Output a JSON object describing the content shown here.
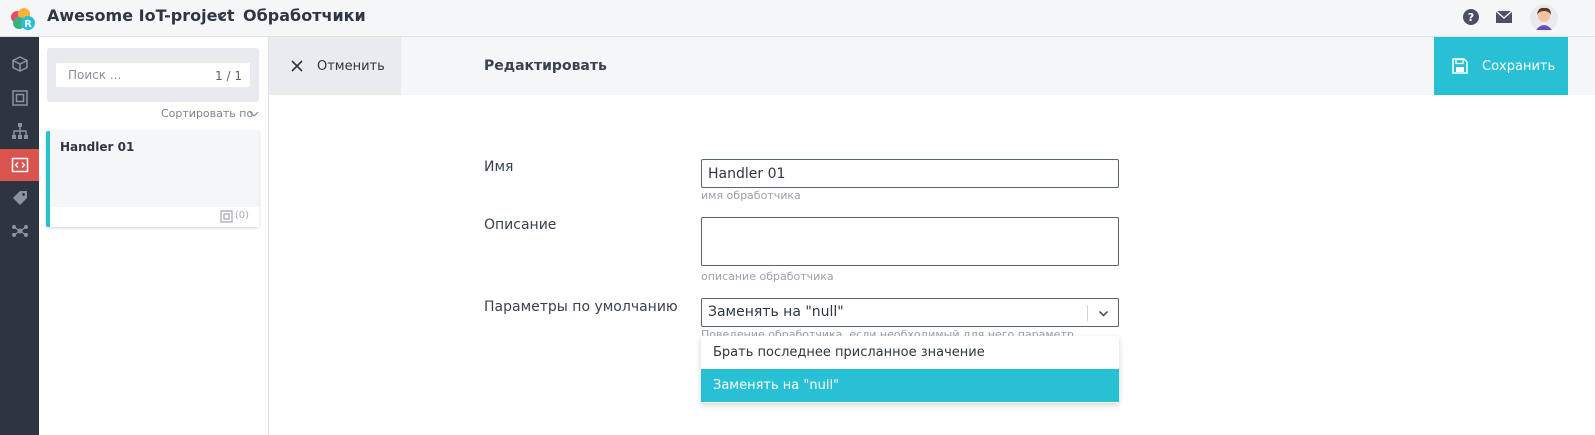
{
  "header": {
    "project_name": "Awesome IoT-project",
    "section_title": "Обработчики"
  },
  "rail": {
    "items": [
      {
        "icon": "cube-icon"
      },
      {
        "icon": "device-frame-icon"
      },
      {
        "icon": "hierarchy-icon"
      },
      {
        "icon": "code-icon",
        "active": true
      },
      {
        "icon": "tag-icon"
      },
      {
        "icon": "network-icon"
      }
    ]
  },
  "list": {
    "search_placeholder": "Поиск ...",
    "count": "1 / 1",
    "sort_label": "Сортировать по",
    "items": [
      {
        "title": "Handler 01",
        "count": "(0)"
      }
    ]
  },
  "actions": {
    "cancel_label": "Отменить",
    "edit_label": "Редактировать",
    "save_label": "Сохранить"
  },
  "form": {
    "name_label": "Имя",
    "name_value": "Handler 01",
    "name_hint": "имя обработчика",
    "description_label": "Описание",
    "description_value": "",
    "description_hint": "описание обработчика",
    "defaults_label": "Параметры по умолчанию",
    "defaults_value": "Заменять на \"null\"",
    "defaults_hint": "Поведение обработчика, если необходимый для него параметр отсутствует в",
    "defaults_options": [
      "Брать последнее присланное значение",
      "Заменять на \"null\""
    ]
  },
  "colors": {
    "accent": "#27c0d4",
    "active_rail": "#d9534f",
    "rail_bg": "#2e3440"
  }
}
